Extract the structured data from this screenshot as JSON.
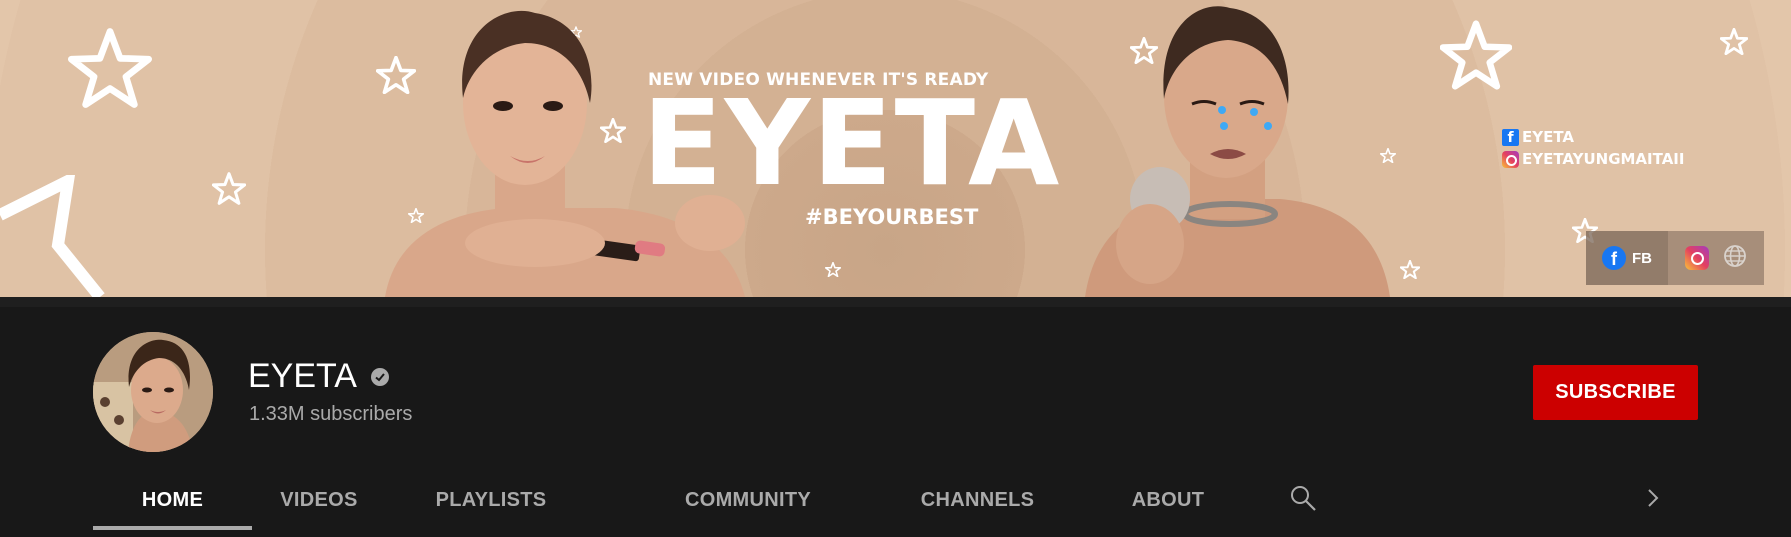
{
  "banner": {
    "tagline": "NEW VIDEO WHENEVER IT'S READY",
    "title": "EYETA",
    "hashtag": "#BEYOURBEST",
    "facebook_handle": "EYETA",
    "instagram_handle": "EYETAYUNGMAITAII",
    "links": {
      "facebook_label": "FB",
      "facebook_icon": "facebook-icon",
      "instagram_icon": "instagram-icon",
      "website_icon": "globe-icon"
    },
    "background_color": "#dcbc9f"
  },
  "channel": {
    "name": "EYETA",
    "verified_icon": "verified-checkmark-icon",
    "subscribers": "1.33M subscribers"
  },
  "subscribe": {
    "label": "SUBSCRIBE",
    "color": "#cc0000"
  },
  "tabs": {
    "items": [
      {
        "label": "HOME"
      },
      {
        "label": "VIDEOS"
      },
      {
        "label": "PLAYLISTS"
      },
      {
        "label": "COMMUNITY"
      },
      {
        "label": "CHANNELS"
      },
      {
        "label": "ABOUT"
      }
    ],
    "active_index": 0,
    "search_icon": "search-icon",
    "next_icon": "chevron-right-icon"
  }
}
